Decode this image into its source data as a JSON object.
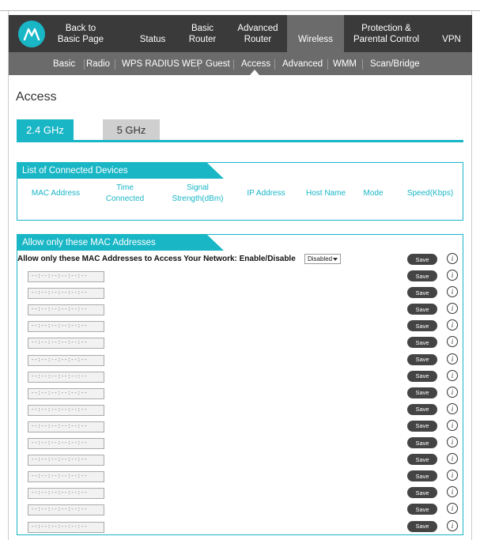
{
  "nav_primary": [
    {
      "label": "Back to Basic Page"
    },
    {
      "label": "Status"
    },
    {
      "label": "Basic Router"
    },
    {
      "label": "Advanced Router"
    },
    {
      "label": "Wireless",
      "active": true
    },
    {
      "label": "Protection & Parental Control"
    },
    {
      "label": "VPN"
    }
  ],
  "nav_secondary": [
    {
      "label": "Basic"
    },
    {
      "label": "Radio"
    },
    {
      "label": "WPS RADIUS WEP"
    },
    {
      "label": "Guest"
    },
    {
      "label": "Access",
      "active": true
    },
    {
      "label": "Advanced"
    },
    {
      "label": "WMM"
    },
    {
      "label": "Scan/Bridge"
    }
  ],
  "page_title": "Access",
  "tabs": [
    {
      "label": "2.4 GHz",
      "active": true
    },
    {
      "label": "5 GHz"
    }
  ],
  "connected_devices": {
    "title": "List of Connected Devices",
    "columns": [
      "MAC Address",
      "Time Connected",
      "Signal Strength(dBm)",
      "IP Address",
      "Host Name",
      "Mode",
      "Speed(Kbps)"
    ]
  },
  "mac_filter": {
    "title": "Allow only these MAC Addresses",
    "enable_label": "Allow only these MAC Addresses to Access Your Network: Enable/Disable",
    "enable_value": "Disabled",
    "save_label": "Save",
    "info_glyph": "i",
    "mac_placeholder": "--:--:--:--:--:--",
    "entry_count": 16
  },
  "colors": {
    "accent": "#19b6c6",
    "nav_dark": "#3a3a3a",
    "nav_mid": "#6b6b6b"
  }
}
